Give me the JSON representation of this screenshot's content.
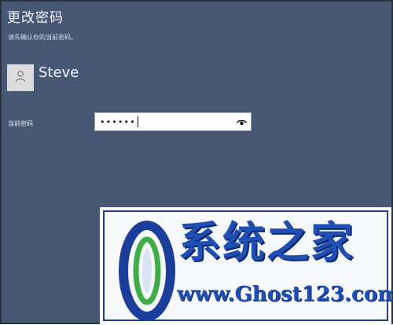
{
  "dialog": {
    "title": "更改密码",
    "subtitle": "请先确认你的当前密码。"
  },
  "account": {
    "username": "Steve",
    "avatar_icon": "user-silhouette-icon"
  },
  "password_field": {
    "label": "当前密码",
    "value": "••••••",
    "reveal_icon": "eye-icon"
  },
  "watermark": {
    "title": "系统之家",
    "url": "www.Ghost123.com"
  },
  "colors": {
    "background": "#475874",
    "text": "#f2f4f8",
    "watermark": "#1f4fb4"
  }
}
